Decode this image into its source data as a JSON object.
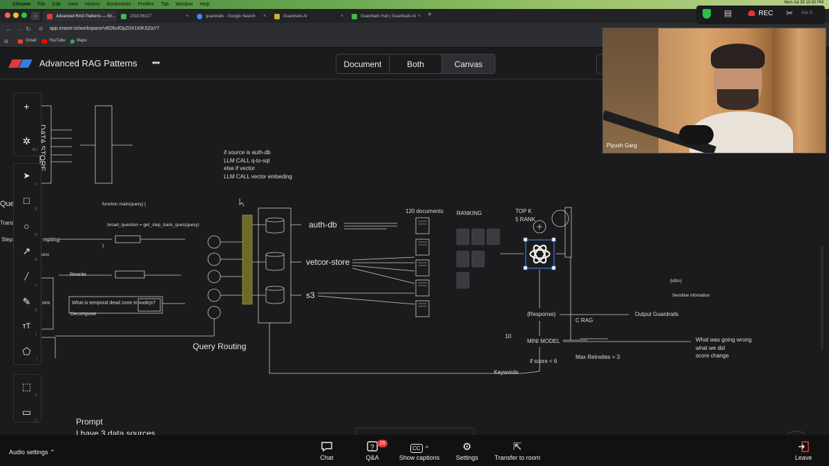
{
  "menubar": {
    "items": [
      "Chrome",
      "File",
      "Edit",
      "View",
      "History",
      "Bookmarks",
      "Profiles",
      "Tab",
      "Window",
      "Help"
    ],
    "clock": "Mon Jul 29  10:30 PM"
  },
  "tabs": [
    {
      "label": "Advanced RAG Patterns — Er…",
      "color": "#e03b3b"
    },
    {
      "label": "2310.06117",
      "color": "#3fb950"
    },
    {
      "label": "guardrails - Google Search",
      "color": "#4285f4"
    },
    {
      "label": "Guardrails AI",
      "color": "#c9b13a"
    },
    {
      "label": "Guardrails Hub | Guardrails AI",
      "color": "#3fb950"
    }
  ],
  "address": {
    "url": "app.eraser.io/workspace/v8O6ufOpZ0X1KlKSZaY7"
  },
  "bookmarks": [
    "Gmail",
    "YouTube",
    "Maps"
  ],
  "app": {
    "title": "Advanced RAG Patterns",
    "views": [
      "Document",
      "Both",
      "Canvas"
    ]
  },
  "tools": [
    {
      "name": "add",
      "glyph": "+",
      "key": ""
    },
    {
      "name": "ai",
      "glyph": "✲",
      "key": "⌘J"
    },
    {
      "name": "select",
      "glyph": "➤",
      "key": "V"
    },
    {
      "name": "rectangle",
      "glyph": "□",
      "key": "R"
    },
    {
      "name": "ellipse",
      "glyph": "○",
      "key": "O"
    },
    {
      "name": "arrow",
      "glyph": "↗",
      "key": "A"
    },
    {
      "name": "line",
      "glyph": "╱",
      "key": "L"
    },
    {
      "name": "pen",
      "glyph": "✎",
      "key": "D"
    },
    {
      "name": "text",
      "glyph": "тT",
      "key": "T"
    },
    {
      "name": "shapes",
      "glyph": "⬠",
      "key": "I"
    },
    {
      "name": "frame",
      "glyph": "⬚",
      "key": "F"
    },
    {
      "name": "comment",
      "glyph": "▭",
      "key": "C"
    }
  ],
  "canvas": {
    "data_store": "DATA STORE",
    "code1": [
      "if source is auth-db",
      "LLM CALL q-to-sql",
      "else if vector",
      "LLM CALL vector embeding"
    ],
    "code2": [
      "function main(query) {",
      "    broad_question = get_step_back_ques(query)",
      "}"
    ],
    "left_clipped": [
      "Que",
      "Trans",
      "Step",
      "mpting",
      "nano",
      "Rewrite",
      "ons",
      "Decompose"
    ],
    "question": "What is temporal dead zone in nodejs?",
    "sources": [
      "auth-db",
      "vetcor-store",
      "s3"
    ],
    "query_routing": "Query Routing",
    "documents": "120 documents",
    "ranking": "RANKING",
    "topk": [
      "TOP K",
      "5 RANK"
    ],
    "response": "{Response}",
    "c_rag": "C RAG",
    "output_guardrails": "Output Guardrails",
    "id3rs": "{id3rs}",
    "sensitive": "Sensitive Infomation",
    "ten": "10",
    "mini_model": "MINI MODEL",
    "notes": [
      "What was going wrong",
      "what we did",
      "score change"
    ],
    "if_score": "if score < 6",
    "max_rewrites": "Max Retrwites = 3",
    "keywords": "Keywords",
    "prompt": "Prompt",
    "prompt2": "I have 3 data sources"
  },
  "webcam": {
    "name": "Piyush Garg"
  },
  "extensions": {
    "rec": "REC",
    "ask": "Ask G"
  },
  "meeting": {
    "audio": "Audio settings",
    "buttons": [
      {
        "label": "Chat",
        "icon": "chat-icon",
        "glyph": "💬"
      },
      {
        "label": "Q&A",
        "icon": "qa-icon",
        "glyph": "?"
      },
      {
        "label": "Show captions",
        "icon": "cc-icon",
        "glyph": "CC"
      },
      {
        "label": "Settings",
        "icon": "gear-icon",
        "glyph": "⚙"
      },
      {
        "label": "Transfer to room",
        "icon": "transfer-icon",
        "glyph": "⇱"
      }
    ],
    "qa_badge": "29",
    "leave": "Leave"
  }
}
